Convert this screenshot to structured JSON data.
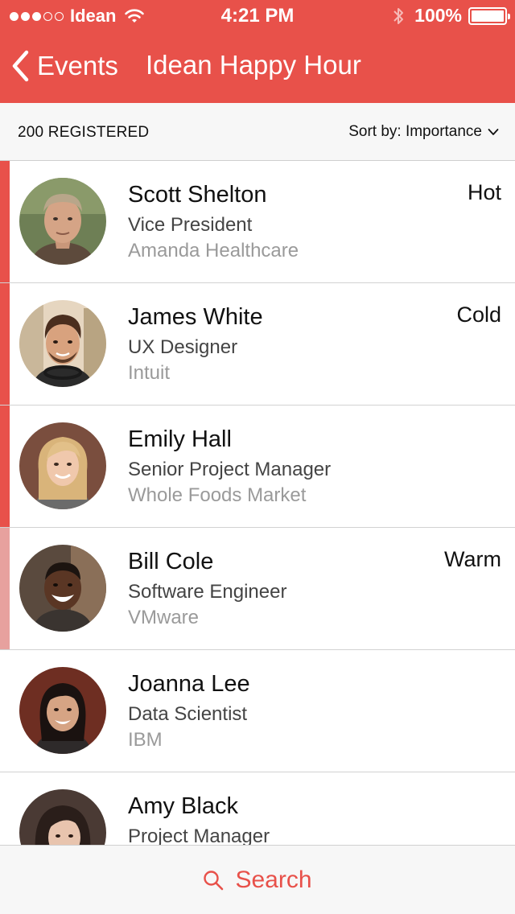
{
  "status_bar": {
    "carrier": "Idean",
    "time": "4:21 PM",
    "battery": "100%",
    "signal_bars_filled": 3,
    "signal_bars_total": 5
  },
  "nav": {
    "back_label": "Events",
    "title": "Idean Happy Hour"
  },
  "subbar": {
    "registered": "200 REGISTERED",
    "sort_label": "Sort by: Importance"
  },
  "attendees": [
    {
      "name": "Scott Shelton",
      "title": "Vice President",
      "company": "Amanda Healthcare",
      "temperature": "Hot",
      "bar_color": "#e8514a"
    },
    {
      "name": "James White",
      "title": "UX Designer",
      "company": "Intuit",
      "temperature": "Cold",
      "bar_color": "#e8514a"
    },
    {
      "name": "Emily Hall",
      "title": "Senior Project Manager",
      "company": "Whole Foods Market",
      "temperature": "",
      "bar_color": "#e8514a"
    },
    {
      "name": "Bill Cole",
      "title": "Software Engineer",
      "company": "VMware",
      "temperature": "Warm",
      "bar_color": "#e7a19e"
    },
    {
      "name": "Joanna Lee",
      "title": "Data Scientist",
      "company": "IBM",
      "temperature": "",
      "bar_color": ""
    },
    {
      "name": "Amy Black",
      "title": "Project Manager",
      "company": "",
      "temperature": "",
      "bar_color": ""
    }
  ],
  "bottom_bar": {
    "search_label": "Search",
    "search_icon": "search-icon"
  },
  "colors": {
    "accent": "#e8514a",
    "header_bg": "#e8514a",
    "subbar_bg": "#f7f7f7",
    "secondary_text": "#9a9a9a"
  }
}
